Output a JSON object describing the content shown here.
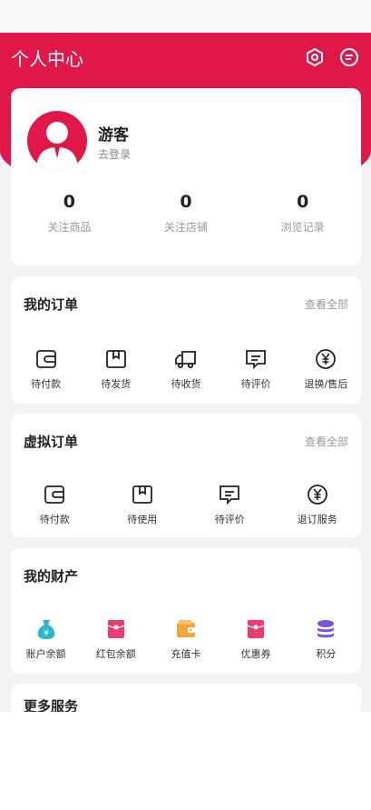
{
  "header": {
    "title": "个人中心",
    "settings_icon": "settings-hex-icon",
    "message_icon": "message-icon",
    "color": "#e0184a"
  },
  "profile": {
    "name": "游客",
    "login": "去登录"
  },
  "stats": [
    {
      "value": "0",
      "label": "关注商品"
    },
    {
      "value": "0",
      "label": "关注店铺"
    },
    {
      "value": "0",
      "label": "浏览记录"
    }
  ],
  "orders": {
    "title": "我的订单",
    "more": "查看全部",
    "items": [
      {
        "label": "待付款",
        "icon": "wallet-icon"
      },
      {
        "label": "待发货",
        "icon": "box-icon"
      },
      {
        "label": "待收货",
        "icon": "truck-icon"
      },
      {
        "label": "待评价",
        "icon": "comment-icon"
      },
      {
        "label": "退换/售后",
        "icon": "yen-icon"
      }
    ]
  },
  "virtual": {
    "title": "虚拟订单",
    "more": "查看全部",
    "items": [
      {
        "label": "待付款",
        "icon": "wallet-icon"
      },
      {
        "label": "待使用",
        "icon": "box-icon"
      },
      {
        "label": "待评价",
        "icon": "comment-icon"
      },
      {
        "label": "退订服务",
        "icon": "yen-icon"
      }
    ]
  },
  "assets": {
    "title": "我的财产",
    "items": [
      {
        "label": "账户余额",
        "icon": "money-bag-icon"
      },
      {
        "label": "红包余额",
        "icon": "red-packet-icon"
      },
      {
        "label": "充值卡",
        "icon": "card-wallet-icon"
      },
      {
        "label": "优惠券",
        "icon": "coupon-icon"
      },
      {
        "label": "积分",
        "icon": "coins-stack-icon"
      }
    ]
  },
  "more": {
    "title": "更多服务"
  }
}
